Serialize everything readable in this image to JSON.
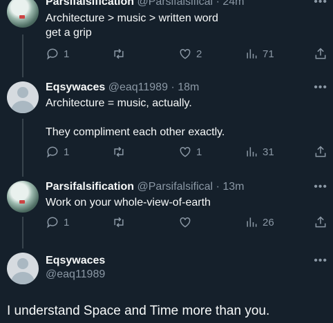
{
  "tweets": [
    {
      "name": "Parsifalsification",
      "handle": "@Parsifalsifical",
      "time": "24m",
      "text": "Architecture > music > written word\nget a grip",
      "replies": "1",
      "retweets": "",
      "likes": "2",
      "views": "71"
    },
    {
      "name": "Eqsywaces",
      "handle": "@eaq11989",
      "time": "18m",
      "text": "Architecture = music, actually.\n\nThey compliment each other exactly.",
      "replies": "1",
      "retweets": "",
      "likes": "1",
      "views": "31"
    },
    {
      "name": "Parsifalsification",
      "handle": "@Parsifalsifical",
      "time": "13m",
      "text": "Work on your whole-view-of-earth",
      "replies": "1",
      "retweets": "",
      "likes": "",
      "views": "26"
    }
  ],
  "main_tweet": {
    "name": "Eqsywaces",
    "handle": "@eaq11989",
    "text": "I understand Space and Time more than you."
  },
  "dot": "·",
  "more": "•••"
}
